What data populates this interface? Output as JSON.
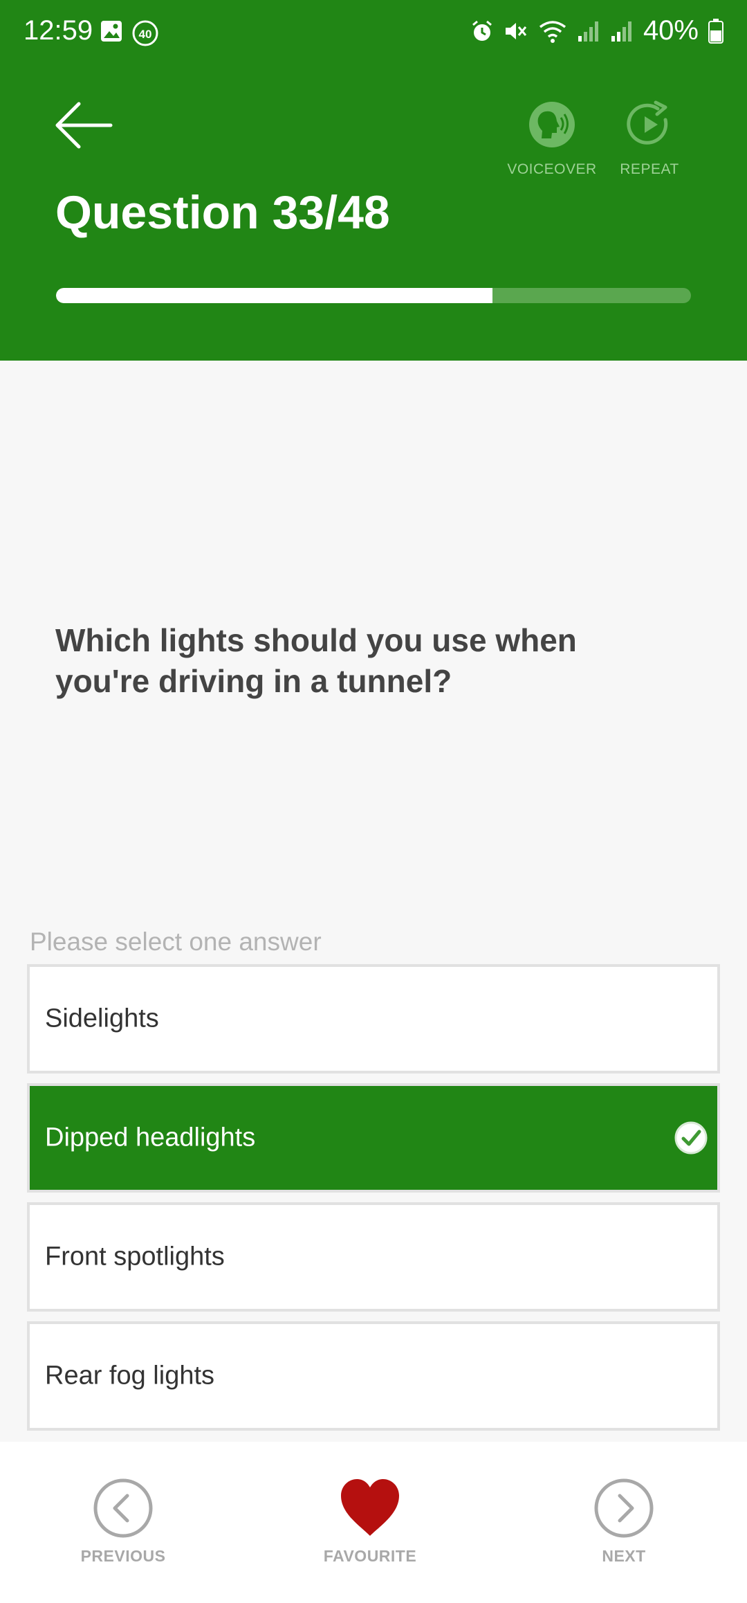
{
  "status_bar": {
    "time": "12:59",
    "notification_badge": "40",
    "battery": "40%"
  },
  "header": {
    "question_counter": "Question 33/48",
    "progress_fraction": 0.6875,
    "voiceover_label": "VOICEOVER",
    "repeat_label": "REPEAT"
  },
  "question": {
    "text": "Which lights should you use when you're driving in a tunnel?"
  },
  "answers": {
    "hint": "Please select one answer",
    "options": [
      {
        "label": "Sidelights",
        "selected": false
      },
      {
        "label": "Dipped headlights",
        "selected": true
      },
      {
        "label": "Front spotlights",
        "selected": false
      },
      {
        "label": "Rear fog lights",
        "selected": false
      }
    ]
  },
  "bottom_nav": {
    "previous_label": "PREVIOUS",
    "favourite_label": "FAVOURITE",
    "next_label": "NEXT"
  },
  "colors": {
    "brand_green": "#218615",
    "favourite_red": "#b5100f"
  }
}
